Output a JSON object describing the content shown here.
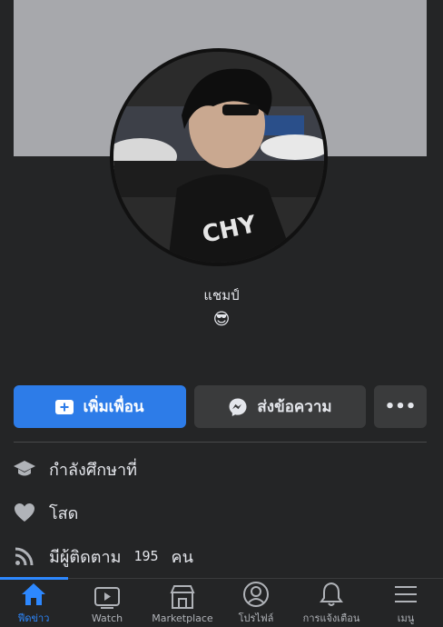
{
  "profile": {
    "name": "แชมป์",
    "bio_emoji": "😎"
  },
  "actions": {
    "add_friend_label": "เพิ่มเพื่อน",
    "message_label": "ส่งข้อความ",
    "more_label": "•••"
  },
  "info": {
    "studying": "กำลังศึกษาที่",
    "relationship": "โสด",
    "followers_prefix": "มีผู้ติดตาม",
    "followers_count": "195",
    "followers_suffix": "คน"
  },
  "tabs": [
    {
      "label": "ฟีดข่าว",
      "icon": "home-icon",
      "active": true
    },
    {
      "label": "Watch",
      "icon": "video-icon"
    },
    {
      "label": "Marketplace",
      "icon": "shop-icon"
    },
    {
      "label": "โปรไฟล์",
      "icon": "profile-icon"
    },
    {
      "label": "การแจ้งเตือน",
      "icon": "bell-icon"
    },
    {
      "label": "เมนู",
      "icon": "menu-icon"
    }
  ],
  "colors": {
    "accent": "#2d88ff",
    "primary_button": "#2d7ce8",
    "background": "#242526",
    "secondary_button": "#3a3b3c"
  }
}
